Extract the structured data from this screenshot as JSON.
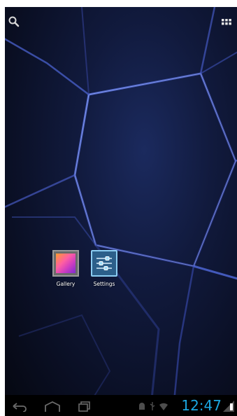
{
  "home": {
    "apps": [
      {
        "label": "Gallery",
        "icon": "gallery-icon"
      },
      {
        "label": "Settings",
        "icon": "settings-icon"
      }
    ]
  },
  "topbar": {
    "search_icon": "search-icon",
    "apps_icon": "all-apps-icon"
  },
  "navbar": {
    "clock": "12:47",
    "buttons": [
      "back-icon",
      "home-icon",
      "recent-apps-icon"
    ],
    "status_icons": [
      "android-debug-icon",
      "usb-icon",
      "wifi-icon",
      "battery-icon"
    ]
  },
  "colors": {
    "clock": "#1ba6e0",
    "wallpaper_dark": "#0a0f24",
    "wallpaper_glow": "#4a6bff"
  }
}
